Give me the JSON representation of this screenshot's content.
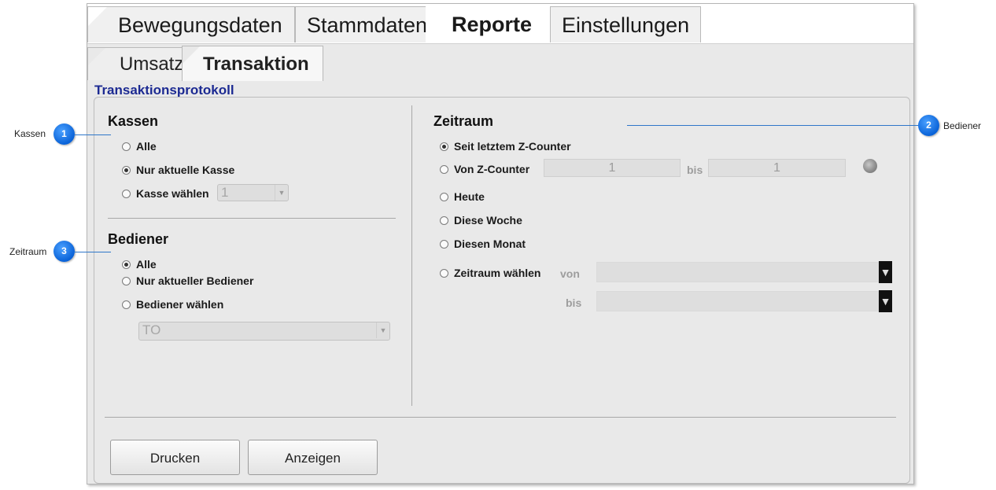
{
  "main_tabs": [
    {
      "label": "Bewegungsdaten",
      "active": false
    },
    {
      "label": "Stammdaten",
      "active": false
    },
    {
      "label": "Reporte",
      "active": true
    },
    {
      "label": "Einstellungen",
      "active": false
    }
  ],
  "sub_tabs": [
    {
      "label": "Umsatz",
      "active": false
    },
    {
      "label": "Transaktion",
      "active": true
    }
  ],
  "section_title": "Transaktionsprotokoll",
  "kassen": {
    "title": "Kassen",
    "options": [
      {
        "label": "Alle",
        "selected": false
      },
      {
        "label": "Nur aktuelle Kasse",
        "selected": true
      },
      {
        "label": "Kasse wählen",
        "selected": false
      }
    ],
    "select_value": "1"
  },
  "bediener": {
    "title": "Bediener",
    "options": [
      {
        "label": "Alle",
        "selected": true
      },
      {
        "label": "Nur aktueller Bediener",
        "selected": false
      },
      {
        "label": "Bediener wählen",
        "selected": false
      }
    ],
    "select_value": "TO"
  },
  "zeitraum": {
    "title": "Zeitraum",
    "options": [
      {
        "label": "Seit letztem Z-Counter",
        "selected": true
      },
      {
        "label": "Von Z-Counter",
        "selected": false
      },
      {
        "label": "Heute",
        "selected": false
      },
      {
        "label": "Diese Woche",
        "selected": false
      },
      {
        "label": "Diesen Monat",
        "selected": false
      },
      {
        "label": "Zeitraum wählen",
        "selected": false
      }
    ],
    "z_from": "1",
    "z_bis_label": "bis",
    "z_to": "1",
    "von_label": "von",
    "bis_label": "bis"
  },
  "buttons": {
    "print": "Drucken",
    "show": "Anzeigen"
  },
  "callouts": [
    {
      "num": "1",
      "label": "Kassen"
    },
    {
      "num": "2",
      "label": "Bediener"
    },
    {
      "num": "3",
      "label": "Zeitraum"
    }
  ],
  "colors": {
    "section_title": "#1c2a92",
    "callout_badge": "#0a63d8"
  }
}
